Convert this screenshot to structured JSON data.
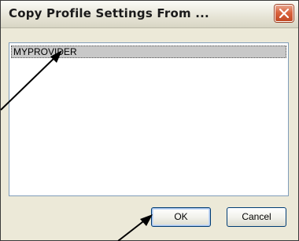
{
  "dialog": {
    "title": "Copy Profile Settings From ...",
    "close_icon": "close-x-icon"
  },
  "list": {
    "items": [
      {
        "label": "MYPROVIDER",
        "selected": true
      }
    ]
  },
  "buttons": {
    "ok_label": "OK",
    "cancel_label": "Cancel"
  },
  "annotations": {
    "arrow_color": "#000000"
  }
}
